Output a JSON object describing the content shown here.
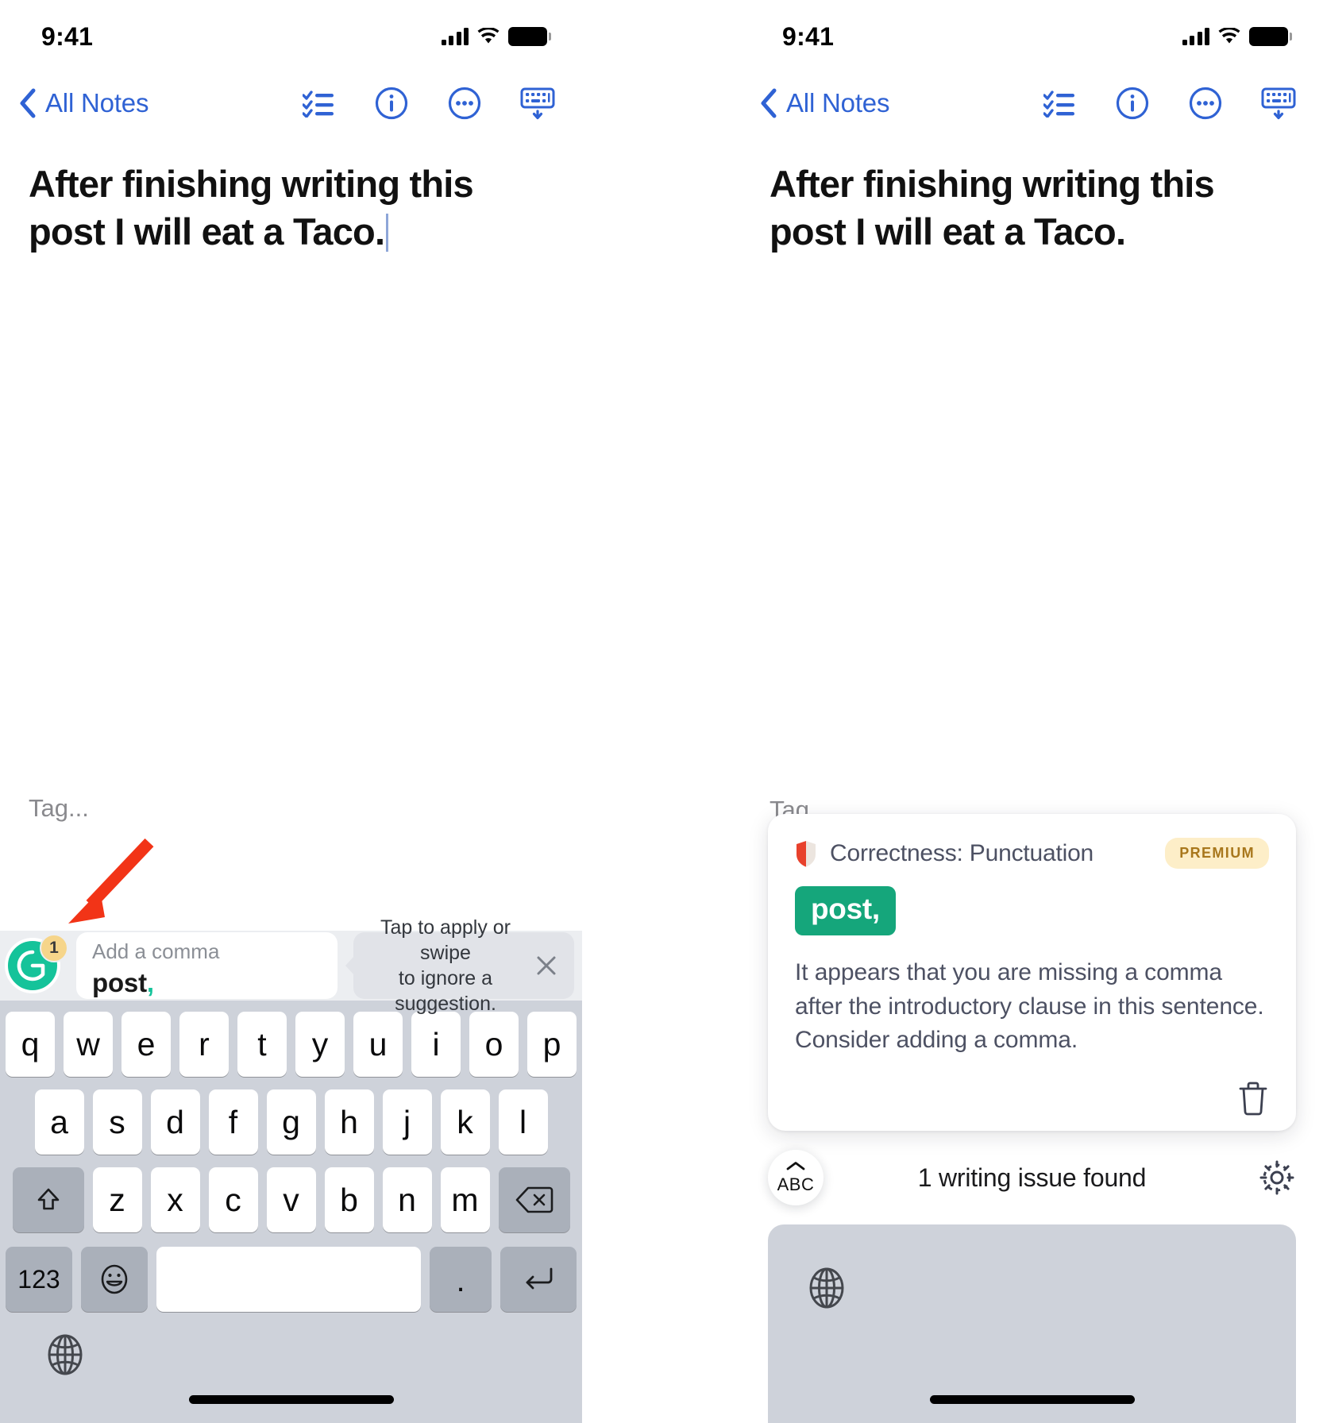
{
  "status_bar": {
    "time": "9:41",
    "signal_icon": "cellular-signal-icon",
    "wifi_icon": "wifi-icon",
    "battery_icon": "battery-full-icon"
  },
  "navbar": {
    "back_label": "All Notes",
    "back_icon": "chevron-left-icon",
    "actions": [
      {
        "name": "checklist-icon",
        "label": "Checklist"
      },
      {
        "name": "info-circle-icon",
        "label": "Info"
      },
      {
        "name": "more-circle-icon",
        "label": "More"
      },
      {
        "name": "keyboard-dismiss-icon",
        "label": "Hide Keyboard"
      }
    ]
  },
  "note": {
    "title": "After finishing writing this post I will eat a Taco.",
    "tag_placeholder": "Tag..."
  },
  "grammarly_bar": {
    "logo_icon": "grammarly-logo-icon",
    "badge_count": "1",
    "card_hint": "Add a comma",
    "card_replacement_text": "post",
    "card_replacement_accent": ",",
    "tip_line_1": "Tap to apply or swipe",
    "tip_line_2": "to ignore a suggestion.",
    "close_icon": "close-icon"
  },
  "keyboard": {
    "row1": [
      "q",
      "w",
      "e",
      "r",
      "t",
      "y",
      "u",
      "i",
      "o",
      "p"
    ],
    "row2": [
      "a",
      "s",
      "d",
      "f",
      "g",
      "h",
      "j",
      "k",
      "l"
    ],
    "row3": [
      "z",
      "x",
      "c",
      "v",
      "b",
      "n",
      "m"
    ],
    "shift_icon": "shift-up-arrow-icon",
    "delete_icon": "backspace-delete-icon",
    "numbers_label": "123",
    "emoji_icon": "emoji-smiley-icon",
    "space_label": "",
    "period_label": ".",
    "return_icon": "return-key-icon",
    "globe_icon": "globe-language-icon"
  },
  "suggestion_card": {
    "shield_icon": "shield-alert-icon",
    "category": "Correctness: Punctuation",
    "premium_badge": "PREMIUM",
    "replacement_chip": "post,",
    "description": "It appears that you are missing a comma after the introductory clause in this sentence. Consider adding a comma.",
    "trash_icon": "trash-delete-icon"
  },
  "status_row": {
    "abc_label": "ABC",
    "abc_chevron_icon": "chevron-up-icon",
    "issue_text": "1 writing issue found",
    "settings_icon": "gear-settings-icon"
  },
  "annotation": {
    "arrow_icon": "red-pointer-arrow-icon",
    "arrow_color": "#f23417"
  },
  "colors": {
    "accent_blue": "#2f62d4",
    "grammarly_green": "#15c39a",
    "chip_green": "#15a67b",
    "premium_bg": "#fdeec8",
    "premium_text": "#a8771c",
    "keyboard_bg": "#ced2da",
    "arrow_red": "#f23417"
  }
}
